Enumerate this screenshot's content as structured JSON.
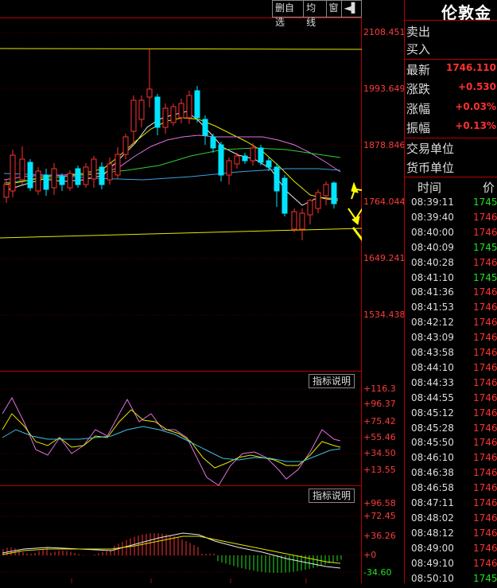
{
  "toolbar": {
    "delete_label": "删自选",
    "ma_label": "均线",
    "window_label": "窗",
    "arrow_label": "◄▌"
  },
  "instrument": {
    "name": "伦敦金"
  },
  "quote": {
    "sell_label": "卖出",
    "buy_label": "买入",
    "latest_label": "最新",
    "latest_value": "1746.110",
    "change_label": "涨跌",
    "change_value": "+0.530",
    "pct_label": "涨幅",
    "pct_value": "+0.03%",
    "amp_label": "振幅",
    "amp_value": "+0.13%",
    "trade_unit_label": "交易单位",
    "currency_unit_label": "货币单位"
  },
  "timeline": {
    "time_header": "时间",
    "price_header": "价",
    "rows": [
      {
        "time": "08:39:11",
        "price": "1745",
        "color": "#20e020"
      },
      {
        "time": "08:39:40",
        "price": "1746",
        "color": "#ff3030"
      },
      {
        "time": "08:40:00",
        "price": "1746",
        "color": "#ff3030"
      },
      {
        "time": "08:40:09",
        "price": "1745",
        "color": "#20e020"
      },
      {
        "time": "08:40:28",
        "price": "1746",
        "color": "#ff3030"
      },
      {
        "time": "08:41:10",
        "price": "1745",
        "color": "#20e020"
      },
      {
        "time": "08:41:36",
        "price": "1746",
        "color": "#ff3030"
      },
      {
        "time": "08:41:53",
        "price": "1746",
        "color": "#ff3030"
      },
      {
        "time": "08:42:12",
        "price": "1746",
        "color": "#ff3030"
      },
      {
        "time": "08:43:09",
        "price": "1746",
        "color": "#ff3030"
      },
      {
        "time": "08:43:58",
        "price": "1746",
        "color": "#ff3030"
      },
      {
        "time": "08:44:10",
        "price": "1746",
        "color": "#ff3030"
      },
      {
        "time": "08:44:33",
        "price": "1746",
        "color": "#ff3030"
      },
      {
        "time": "08:44:55",
        "price": "1746",
        "color": "#ff3030"
      },
      {
        "time": "08:45:12",
        "price": "1746",
        "color": "#ff3030"
      },
      {
        "time": "08:45:28",
        "price": "1746",
        "color": "#ff3030"
      },
      {
        "time": "08:45:50",
        "price": "1746",
        "color": "#ff3030"
      },
      {
        "time": "08:46:10",
        "price": "1746",
        "color": "#ff3030"
      },
      {
        "time": "08:46:38",
        "price": "1746",
        "color": "#ff3030"
      },
      {
        "time": "08:46:58",
        "price": "1746",
        "color": "#ff3030"
      },
      {
        "time": "08:47:11",
        "price": "1746",
        "color": "#ff3030"
      },
      {
        "time": "08:48:02",
        "price": "1746",
        "color": "#ff3030"
      },
      {
        "time": "08:48:12",
        "price": "1746",
        "color": "#ff3030"
      },
      {
        "time": "08:49:00",
        "price": "1746",
        "color": "#ff3030"
      },
      {
        "time": "08:49:10",
        "price": "1746",
        "color": "#ff3030"
      },
      {
        "time": "08:50:10",
        "price": "1745",
        "color": "#20e020"
      }
    ]
  },
  "main_axis": [
    "2108.451",
    "1993.649",
    "1878.846",
    "1764.044",
    "1649.241",
    "1534.438"
  ],
  "kdj_panel": {
    "button": "指标说明",
    "axis": [
      "+116.3",
      "+96.37",
      "+75.42",
      "+55.46",
      "+34.50",
      "+13.55"
    ]
  },
  "macd_panel": {
    "button": "指标说明",
    "axis": [
      "+96.58",
      "+72.45",
      "+36.26",
      "+0",
      "-34.60"
    ]
  },
  "colors": {
    "up": "#ff3030",
    "down": "#00e5ff",
    "panel_border": "#b00000"
  }
}
